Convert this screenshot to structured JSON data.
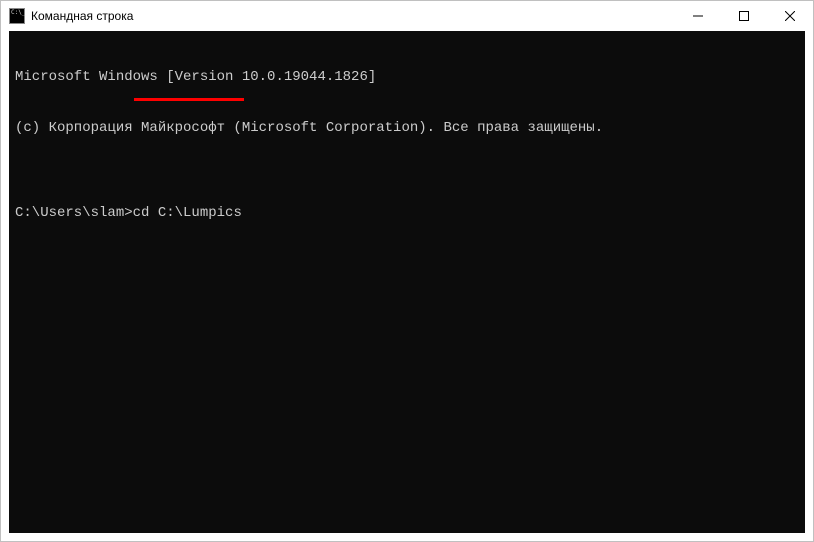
{
  "window": {
    "title": "Командная строка"
  },
  "terminal": {
    "line1": "Microsoft Windows [Version 10.0.19044.1826]",
    "line2": "(c) Корпорация Майкрософт (Microsoft Corporation). Все права защищены.",
    "blank": "",
    "prompt": "C:\\Users\\slam>",
    "command": "cd C:\\Lumpics"
  },
  "annotation": {
    "color": "#ff0000"
  }
}
